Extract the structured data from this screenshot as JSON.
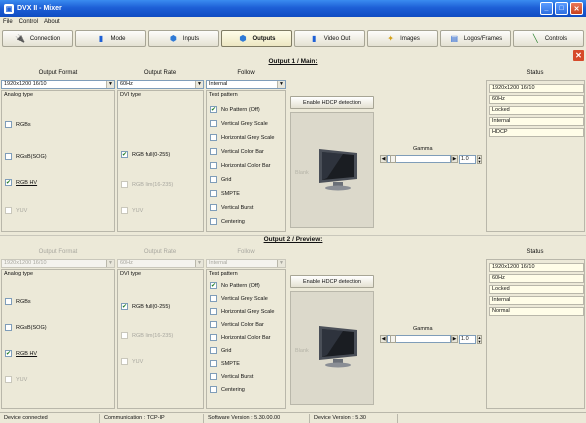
{
  "window": {
    "title": "DVX II - Mixer"
  },
  "menu": [
    "File",
    "Control",
    "About"
  ],
  "tabs": [
    {
      "label": "Connection",
      "icon": "connection-icon"
    },
    {
      "label": "Mode",
      "icon": "mode-icon"
    },
    {
      "label": "Inputs",
      "icon": "inputs-icon"
    },
    {
      "label": "Outputs",
      "icon": "outputs-icon"
    },
    {
      "label": "Video Out",
      "icon": "video-out-icon"
    },
    {
      "label": "Images",
      "icon": "images-icon"
    },
    {
      "label": "Logos/Frames",
      "icon": "logos-frames-icon"
    },
    {
      "label": "Controls",
      "icon": "controls-icon"
    }
  ],
  "active_tab": "Outputs",
  "output1": {
    "title": "Output 1 / Main:",
    "format_label": "Output Format",
    "rate_label": "Output Rate",
    "follow_label": "Follow",
    "status_label": "Status",
    "format_value": "1920x1200 16/10",
    "rate_value": "60Hz",
    "follow_value": "Internal",
    "analog_label": "Analog type",
    "analog": [
      "RGBs",
      "RGsB(SOG)",
      "RGB HV",
      "YUV"
    ],
    "dvi_label": "DVI type",
    "dvi": [
      "RGB full(0-255)",
      "RGB lim(16-235)",
      "YUV"
    ],
    "test_label": "Test pattern",
    "tests": [
      "No Pattern (Off)",
      "Vertical Grey Scale",
      "Horizontal Grey Scale",
      "Vertical Color Bar",
      "Horizontal Color Bar",
      "Grid",
      "SMPTE",
      "Vertical Burst",
      "Centering"
    ],
    "hdcp_label": "Enable HDCP detection",
    "blank_label": "Blank",
    "gamma_label": "Gamma",
    "gamma_value": "1.0",
    "status": [
      "1920x1200 16/10",
      "60Hz",
      "Locked",
      "Internal",
      "HDCP"
    ]
  },
  "output2": {
    "title": "Output 2 / Preview:",
    "format_label": "Output Format",
    "rate_label": "Output Rate",
    "follow_label": "Follow",
    "status_label": "Status",
    "format_value": "1920x1200 16/10",
    "rate_value": "60Hz",
    "follow_value": "Internal",
    "analog_label": "Analog type",
    "analog": [
      "RGBs",
      "RGsB(SOG)",
      "RGB HV",
      "YUV"
    ],
    "dvi_label": "DVI type",
    "dvi": [
      "RGB full(0-255)",
      "RGB lim(16-235)",
      "YUV"
    ],
    "test_label": "Test pattern",
    "tests": [
      "No Pattern (Off)",
      "Vertical Grey Scale",
      "Horizontal Grey Scale",
      "Vertical Color Bar",
      "Horizontal Color Bar",
      "Grid",
      "SMPTE",
      "Vertical Burst",
      "Centering"
    ],
    "hdcp_label": "Enable HDCP detection",
    "blank_label": "Blank",
    "gamma_label": "Gamma",
    "gamma_value": "1.0",
    "status": [
      "1920x1200 16/10",
      "60Hz",
      "Locked",
      "Internal",
      "Normal"
    ]
  },
  "statusbar": {
    "device": "Device connected",
    "communication": "Communication : TCP-IP",
    "software": "Software Version : 5.30.00.00",
    "device_version": "Device Version : 5.30"
  }
}
